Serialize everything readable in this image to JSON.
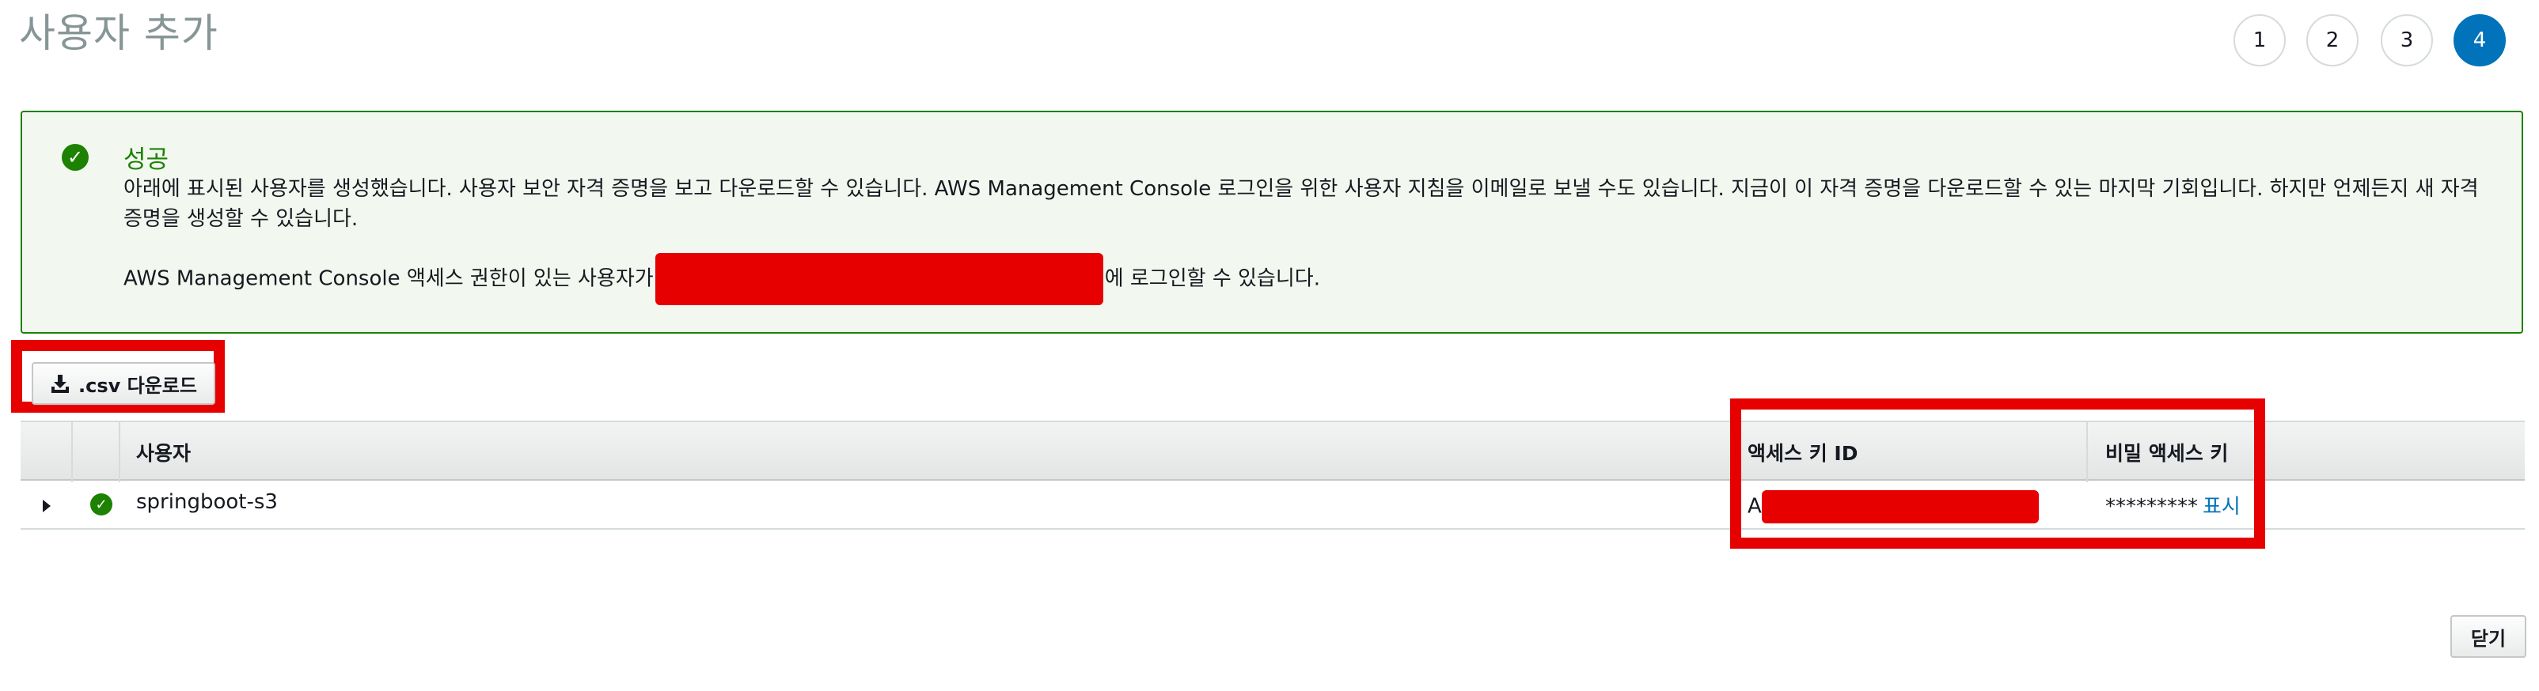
{
  "header": {
    "title": "사용자 추가",
    "steps": [
      "1",
      "2",
      "3",
      "4"
    ],
    "active_step": "4"
  },
  "success": {
    "title": "성공",
    "message": "아래에 표시된 사용자를 생성했습니다. 사용자 보안 자격 증명을 보고 다운로드할 수 있습니다. AWS Management Console 로그인을 위한 사용자 지침을 이메일로 보낼 수도 있습니다. 지금이 이 자격 증명을 다운로드할 수 있는 마지막 기회입니다. 하지만 언제든지 새 자격 증명을 생성할 수 있습니다.",
    "signin_prefix": "AWS Management Console 액세스 권한이 있는 사용자가",
    "signin_suffix": "에 로그인할 수 있습니다."
  },
  "toolbar": {
    "csv_label": ".csv 다운로드"
  },
  "table": {
    "columns": [
      "사용자",
      "액세스 키 ID",
      "비밀 액세스 키"
    ],
    "rows": [
      {
        "user": "springboot-s3",
        "access_key_prefix": "A",
        "secret_mask": "*********",
        "show_label": "표시"
      }
    ]
  },
  "footer": {
    "close_label": "닫기"
  },
  "colors": {
    "success": "#1d8102",
    "primary": "#0073bb",
    "redaction": "#e60000"
  }
}
